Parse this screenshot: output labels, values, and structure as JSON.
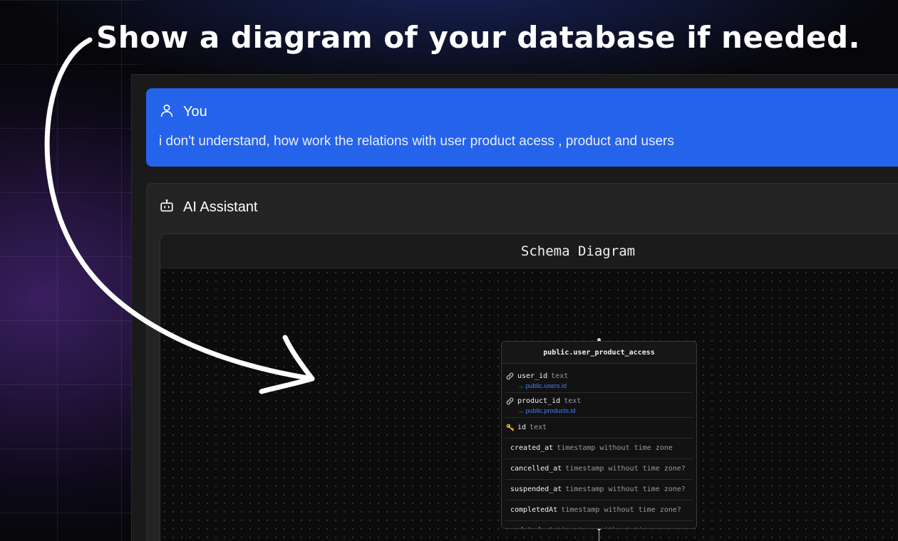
{
  "headline": "Show a diagram of your database if needed.",
  "user_message": {
    "author": "You",
    "author_icon": "user-icon",
    "text": "i don't understand, how work the relations with user product acess , product and users",
    "color": "#2563eb"
  },
  "assistant": {
    "author": "AI Assistant",
    "author_icon": "bot-icon",
    "diagram": {
      "title": "Schema Diagram",
      "table": {
        "name": "public.user_product_access",
        "columns": [
          {
            "icon": "link-icon",
            "name": "user_id",
            "type": "text",
            "ref": "→ public.users.id"
          },
          {
            "icon": "link-icon",
            "name": "product_id",
            "type": "text",
            "ref": "→ public.products.id"
          },
          {
            "icon": "key-icon",
            "name": "id",
            "type": "text",
            "ref": ""
          },
          {
            "icon": "",
            "name": "created_at",
            "type": "timestamp without time zone",
            "ref": ""
          },
          {
            "icon": "",
            "name": "cancelled_at",
            "type": "timestamp without time zone?",
            "ref": ""
          },
          {
            "icon": "",
            "name": "suspended_at",
            "type": "timestamp without time zone?",
            "ref": ""
          },
          {
            "icon": "",
            "name": "completedAt",
            "type": "timestamp without time zone?",
            "ref": ""
          },
          {
            "icon": "",
            "name": "updated_at",
            "type": "timestamp without time zone",
            "ref": ""
          }
        ]
      }
    }
  },
  "colors": {
    "accent": "#2563eb",
    "reference_link": "#4c7cf0",
    "panel": "#242424"
  }
}
